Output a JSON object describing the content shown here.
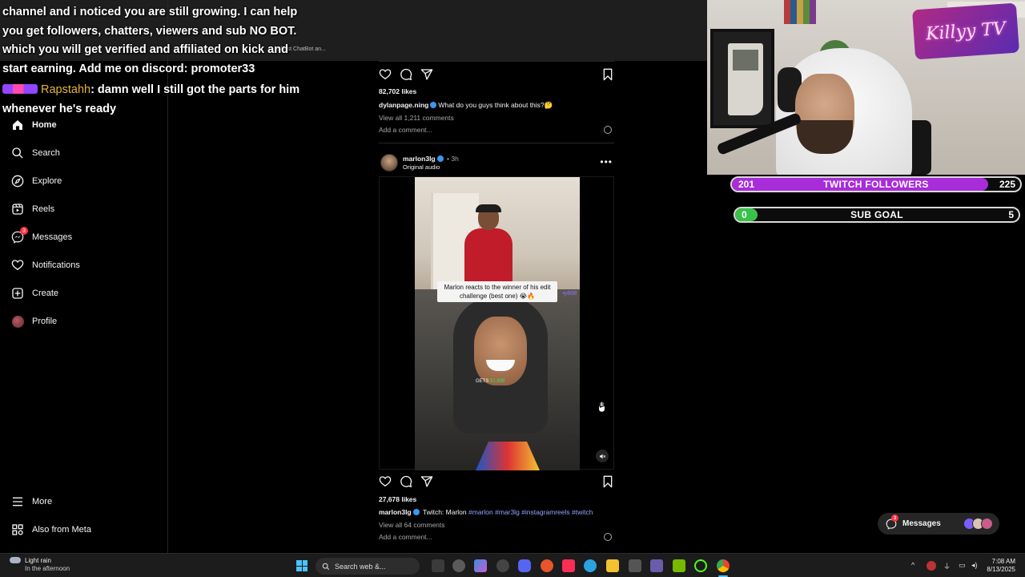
{
  "sidebar": {
    "items": [
      {
        "label": "Home",
        "icon": "home-icon"
      },
      {
        "label": "Search",
        "icon": "search-icon"
      },
      {
        "label": "Explore",
        "icon": "compass-icon"
      },
      {
        "label": "Reels",
        "icon": "reels-icon"
      },
      {
        "label": "Messages",
        "icon": "messenger-icon",
        "badge": "3"
      },
      {
        "label": "Notifications",
        "icon": "heart-icon"
      },
      {
        "label": "Create",
        "icon": "plus-square-icon"
      },
      {
        "label": "Profile",
        "icon": "avatar"
      },
      {
        "label": "More",
        "icon": "hamburger-icon"
      },
      {
        "label": "Also from Meta",
        "icon": "meta-icon"
      }
    ]
  },
  "post1": {
    "likes": "82,702 likes",
    "user": "dylanpage.ning",
    "caption": "What do you guys think about this?🤔",
    "comments": "View all 1,211 comments",
    "add_comment": "Add a comment..."
  },
  "post2": {
    "user": "marlon3lg",
    "time": "• 3h",
    "audio": "Original audio",
    "video_caption": "Marlon reacts to the winner of his edit challenge (best one) 😭🔥",
    "video_overlay": "GETS",
    "video_overlay_amount": "$1,888",
    "video_tag": "•y808",
    "likes": "27,678 likes",
    "caption_text": "Twitch: Marlon",
    "hashtags": "#marlon #mar3lg #instagramreels #twitch",
    "comments": "View all 64 comments",
    "add_comment": "Add a comment..."
  },
  "chat": {
    "lines": [
      "channel and i noticed you are still growing. I can help",
      "you get followers, chatters, viewers and sub NO BOT.",
      "which you will get verified and affiliated on kick and",
      "start earning. Add me on discord: promoter33"
    ],
    "ghost": "e best ChatBot an...",
    "user2": "Rapstahh",
    "msg2a": ": damn well I still got the parts for him",
    "msg2b": "whenever he's ready"
  },
  "webcam": {
    "logo_text": "Killyy TV"
  },
  "goals": {
    "followers": {
      "label": "TWITCH FOLLOWERS",
      "current": "201",
      "target": "225",
      "progress": 0.893,
      "color": "#a82cd9"
    },
    "sub": {
      "label": "SUB GOAL",
      "current": "0",
      "target": "5",
      "progress": 0.0,
      "color": "#38c24a"
    }
  },
  "messages_pill": {
    "label": "Messages",
    "badge": "3"
  },
  "taskbar": {
    "weather_title": "Light rain",
    "weather_sub": "In the afternoon",
    "search_label": "Search web &...",
    "time": "7:08 AM",
    "date": "8/13/2025"
  },
  "colors": {
    "accent": "#3897f0",
    "hashtag": "#8ea6ff",
    "background": "#000000"
  }
}
